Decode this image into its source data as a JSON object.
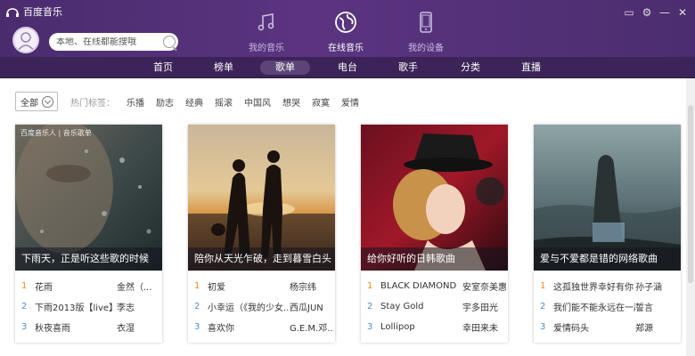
{
  "app": {
    "title": "百度音乐"
  },
  "search": {
    "placeholder": "本地、在线都能搜哦"
  },
  "main_tabs": [
    {
      "label": "我的音乐",
      "icon": "music-note-icon"
    },
    {
      "label": "在线音乐",
      "icon": "globe-icon"
    },
    {
      "label": "我的设备",
      "icon": "phone-icon"
    }
  ],
  "sub_nav": [
    "首页",
    "榜单",
    "歌单",
    "电台",
    "歌手",
    "分类",
    "直播"
  ],
  "filter": {
    "all_label": "全部",
    "hot_label": "热门标签：",
    "tags": [
      "乐播",
      "励志",
      "经典",
      "摇滚",
      "中国风",
      "想哭",
      "寂寞",
      "爱情"
    ]
  },
  "playlists": [
    {
      "caption": "下雨天，正是听这些歌的时候",
      "watermark": "百度音乐人 | 音乐歌单",
      "songs": [
        {
          "num": "1",
          "title": "花雨",
          "artist": "金然（..."
        },
        {
          "num": "2",
          "title": "下雨2013版【live】",
          "artist": "李志"
        },
        {
          "num": "3",
          "title": "秋夜喜雨",
          "artist": "衣湿"
        }
      ]
    },
    {
      "caption": "陪你从天光乍破，走到暮雪白头",
      "watermark": "",
      "songs": [
        {
          "num": "1",
          "title": "初爱",
          "artist": "杨宗纬"
        },
        {
          "num": "2",
          "title": "小幸运（《我的少女...",
          "artist": "西瓜JUN"
        },
        {
          "num": "3",
          "title": "喜欢你",
          "artist": "G.E.M.邓..."
        }
      ]
    },
    {
      "caption": "给你好听的日韩歌曲",
      "watermark": "",
      "songs": [
        {
          "num": "1",
          "title": "BLACK DIAMOND",
          "artist": "安室奈美惠"
        },
        {
          "num": "2",
          "title": "Stay Gold",
          "artist": "宇多田光"
        },
        {
          "num": "3",
          "title": "Lollipop",
          "artist": "幸田来未"
        }
      ]
    },
    {
      "caption": "爱与不爱都是错的网络歌曲",
      "watermark": "",
      "songs": [
        {
          "num": "1",
          "title": "这孤独世界幸好有你",
          "artist": "孙子涵"
        },
        {
          "num": "2",
          "title": "我们能不能永远在一起",
          "artist": "誓言"
        },
        {
          "num": "3",
          "title": "爱情码头",
          "artist": "郑源"
        }
      ]
    }
  ],
  "colors": {
    "header": "#4a2c6e",
    "subnav": "#3c2458",
    "accent_num": "#f08a24",
    "second_num": "#4a90d9"
  }
}
